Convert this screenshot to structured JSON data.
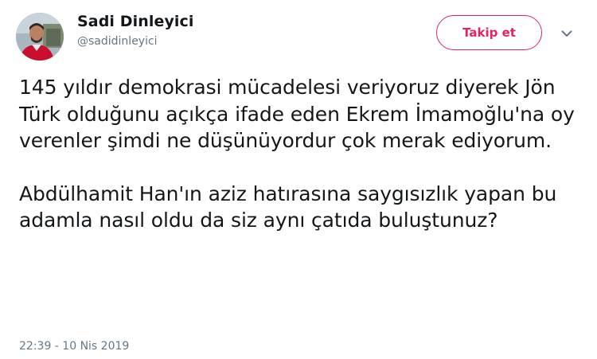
{
  "user": {
    "display_name": "Sadi Dinleyici",
    "handle": "@sadidinleyici",
    "avatar_icon": "profile-photo"
  },
  "actions": {
    "follow_label": "Takip et",
    "menu_icon": "chevron-down-icon"
  },
  "tweet": {
    "paragraph_1": "145 yıldır demokrasi mücadelesi veriyoruz diyerek Jön Türk olduğunu açıkça ifade eden Ekrem İmamoğlu'na oy verenler şimdi ne düşünüyordur çok merak ediyorum.",
    "paragraph_2": "Abdülhamit Han'ın aziz hatırasına saygısızlık yapan bu adamla nasıl oldu da siz aynı çatıda buluştunuz?",
    "timestamp": "22:39 - 10 Nis 2019"
  },
  "colors": {
    "accent": "#e0245e",
    "text": "#14171a",
    "secondary": "#657786"
  }
}
